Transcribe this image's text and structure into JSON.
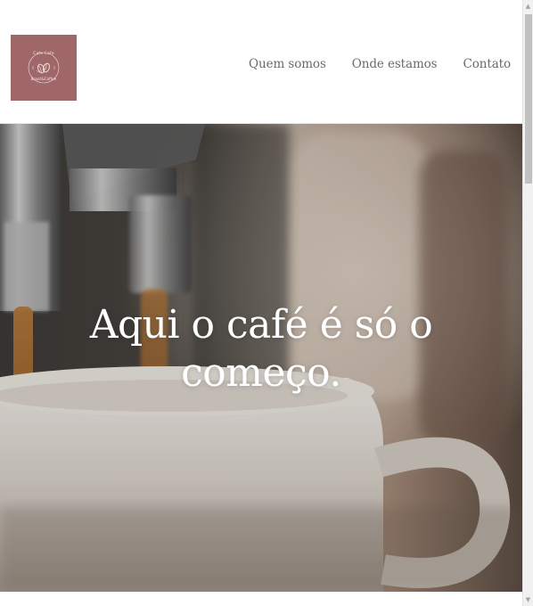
{
  "header": {
    "logo": {
      "text_top": "Cafe Cafe",
      "text_bottom": "Brasil&Coffee",
      "color": "#a06768"
    },
    "nav": [
      {
        "label": "Quem somos"
      },
      {
        "label": "Onde estamos"
      },
      {
        "label": "Contato"
      }
    ]
  },
  "hero": {
    "title_line1": "Aqui o café é só o",
    "title_line2": "começo."
  },
  "colors": {
    "logo_bg": "#a06768",
    "nav_text": "#6a6a6a",
    "hero_text": "#ffffff"
  },
  "icons": {
    "logo_mark": "coffee-beans-icon",
    "scroll_up": "chevron-up-icon",
    "scroll_down": "chevron-down-icon"
  }
}
